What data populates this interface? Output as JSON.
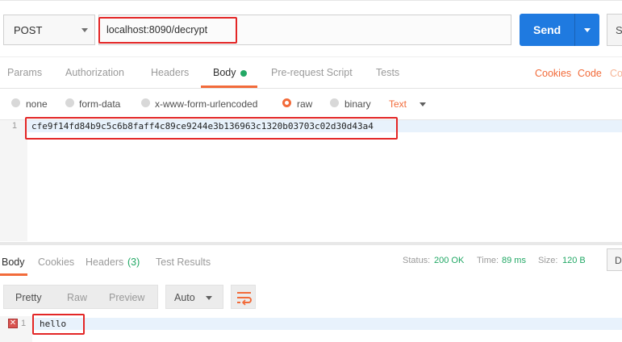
{
  "request": {
    "method": "POST",
    "url": "localhost:8090/decrypt",
    "send_label": "Send",
    "save_partial": "S"
  },
  "request_tabs": [
    {
      "label": "Params"
    },
    {
      "label": "Authorization"
    },
    {
      "label": "Headers"
    },
    {
      "label": "Body"
    },
    {
      "label": "Pre-request Script"
    },
    {
      "label": "Tests"
    }
  ],
  "request_links": {
    "cookies": "Cookies",
    "code": "Code",
    "partial": "Co"
  },
  "body_types": {
    "none": "none",
    "form_data": "form-data",
    "urlencoded": "x-www-form-urlencoded",
    "raw": "raw",
    "binary": "binary",
    "format": "Text"
  },
  "editor": {
    "line_number": "1",
    "content": "cfe9f14fd84b9c5c6b8faff4c89ce9244e3b136963c1320b03703c02d30d43a4"
  },
  "response_tabs": {
    "body": "Body",
    "cookies": "Cookies",
    "headers": "Headers",
    "headers_count": "(3)",
    "test_results": "Test Results"
  },
  "status_bar": {
    "status_label": "Status:",
    "status_value": "200 OK",
    "time_label": "Time:",
    "time_value": "89 ms",
    "size_label": "Size:",
    "size_value": "120 B",
    "download_partial": "D"
  },
  "view_modes": {
    "pretty": "Pretty",
    "raw": "Raw",
    "preview": "Preview",
    "format": "Auto"
  },
  "response_body": {
    "line_number": "1",
    "content": "hello"
  },
  "colors": {
    "accent": "#f26b3a",
    "send": "#1f7ae0",
    "status_ok": "#22a865",
    "highlight": "#e32626"
  }
}
